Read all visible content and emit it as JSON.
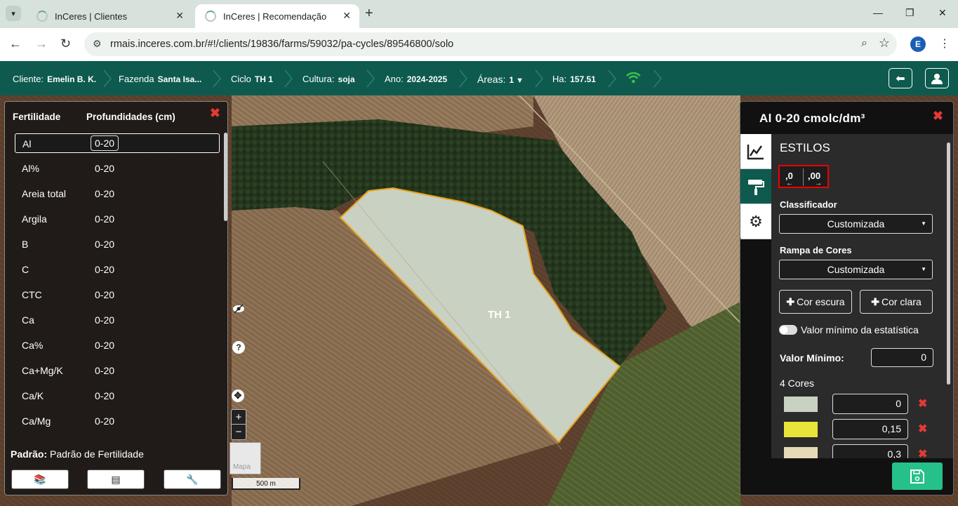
{
  "browser": {
    "tabs": [
      {
        "title": "InCeres | Clientes",
        "active": false
      },
      {
        "title": "InCeres | Recomendação",
        "active": true
      }
    ],
    "url": "rmais.inceres.com.br/#!/clients/19836/farms/59032/pa-cycles/89546800/solo",
    "profile_initial": "E"
  },
  "header": {
    "cliente_label": "Cliente:",
    "cliente_value": "Emelin B. K.",
    "fazenda_label": "Fazenda",
    "fazenda_value": "Santa Isa...",
    "ciclo_label": "Ciclo",
    "ciclo_value": "TH 1",
    "cultura_label": "Cultura:",
    "cultura_value": "soja",
    "ano_label": "Ano:",
    "ano_value": "2024-2025",
    "areas_label": "Áreas:",
    "areas_value": "1",
    "ha_label": "Ha:",
    "ha_value": "157.51",
    "wifi_color": "#3cc24a"
  },
  "left_panel": {
    "col_fertilidade": "Fertilidade",
    "col_profundidades": "Profundidades (cm)",
    "rows": [
      {
        "name": "Al",
        "depth": "0-20"
      },
      {
        "name": "Al%",
        "depth": "0-20"
      },
      {
        "name": "Areia total",
        "depth": "0-20"
      },
      {
        "name": "Argila",
        "depth": "0-20"
      },
      {
        "name": "B",
        "depth": "0-20"
      },
      {
        "name": "C",
        "depth": "0-20"
      },
      {
        "name": "CTC",
        "depth": "0-20"
      },
      {
        "name": "Ca",
        "depth": "0-20"
      },
      {
        "name": "Ca%",
        "depth": "0-20"
      },
      {
        "name": "Ca+Mg/K",
        "depth": "0-20"
      },
      {
        "name": "Ca/K",
        "depth": "0-20"
      },
      {
        "name": "Ca/Mg",
        "depth": "0-20"
      }
    ],
    "padrao_label": "Padrão:",
    "padrao_value": "Padrão de Fertilidade"
  },
  "map": {
    "polygon_label": "TH 1",
    "minimap_label": "Mapa",
    "scale_label": "500 m",
    "polygon_fill": "#c9d1c2",
    "polygon_stroke": "#e8a21a"
  },
  "right_panel": {
    "title": "Al 0-20 cmolc/dm³",
    "section_title": "ESTILOS",
    "decimals_decrease": ",0",
    "decimals_increase": ",00",
    "classificador_label": "Classificador",
    "classificador_value": "Customizada",
    "rampa_label": "Rampa de Cores",
    "rampa_value": "Customizada",
    "cor_escura": "Cor escura",
    "cor_clara": "Cor clara",
    "toggle_label": "Valor mínimo da estatística",
    "valor_minimo_label": "Valor Mínimo:",
    "valor_minimo_value": "0",
    "cores_label": "4 Cores",
    "colors": [
      {
        "hex": "#c9d1c2",
        "value": "0"
      },
      {
        "hex": "#e9e43a",
        "value": "0,15"
      },
      {
        "hex": "#e5d9b8",
        "value": "0,3"
      }
    ]
  }
}
